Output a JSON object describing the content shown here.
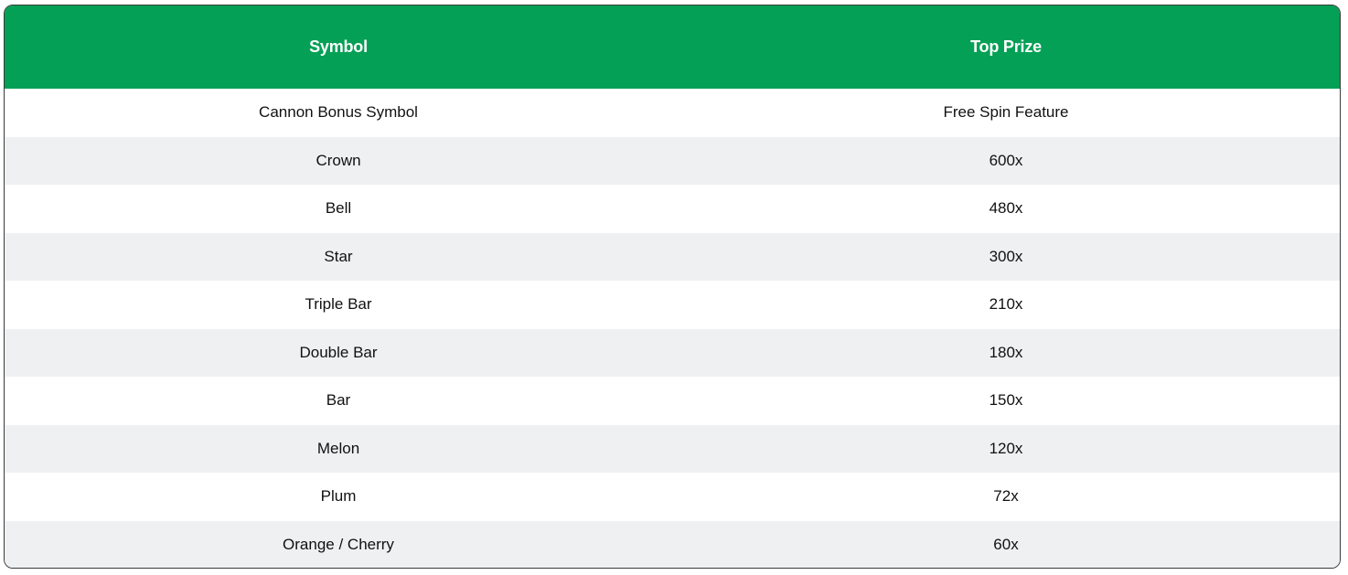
{
  "table": {
    "headers": [
      "Symbol",
      "Top Prize"
    ],
    "rows": [
      [
        "Cannon Bonus Symbol",
        "Free Spin Feature"
      ],
      [
        "Crown",
        "600x"
      ],
      [
        "Bell",
        "480x"
      ],
      [
        "Star",
        "300x"
      ],
      [
        "Triple Bar",
        "210x"
      ],
      [
        "Double Bar",
        "180x"
      ],
      [
        "Bar",
        "150x"
      ],
      [
        "Melon",
        "120x"
      ],
      [
        "Plum",
        "72x"
      ],
      [
        "Orange / Cherry",
        "60x"
      ]
    ]
  },
  "colors": {
    "header_bg": "#04a055",
    "stripe_bg": "#eef0f1"
  }
}
